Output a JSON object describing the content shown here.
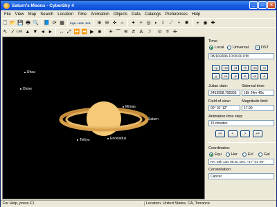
{
  "window": {
    "title": "Saturn's Moons - CyberSky 4"
  },
  "menu": [
    "File",
    "View",
    "Map",
    "Search",
    "Location",
    "Time",
    "Animation",
    "Objects",
    "Data",
    "Catalogs",
    "Preferences",
    "Help"
  ],
  "toolbar": {
    "leo_label": "Leo"
  },
  "sky": {
    "planet_label": "Saturn",
    "moons": {
      "rhea": "Rhea",
      "dione": "Dione",
      "mimas": "Mimas",
      "tethys": "Tethys",
      "enceladus": "Enceladus"
    },
    "colors": {
      "planet": "#f6c979",
      "rings": "#d8a04a",
      "background": "#000000"
    }
  },
  "panel": {
    "time_label": "Time:",
    "local_label": "Local",
    "universal_label": "Universal",
    "dst_label": "DST",
    "datetime_value": "08/10/2006 10:06:00 PM",
    "step_buttons": [
      "+y",
      "+m",
      "+d",
      "+h",
      "+m",
      "+s",
      "-y",
      "-m",
      "-d",
      "-h",
      "-m",
      "-s"
    ],
    "julian_label": "Julian date:",
    "julian_value": "2453958.708333",
    "sidereal_label": "Sidereal time:",
    "sidereal_value": "18h 24m 45s",
    "fov_label": "Field of view:",
    "fov_value": "00° 01' 12\"",
    "maglimit_label": "Magnitude limit:",
    "maglimit_value": "17.90",
    "anim_label": "Animation time step:",
    "anim_value": "15 minutes",
    "nav_buttons": [
      "<<",
      "<",
      ">",
      ">>"
    ],
    "coords_label": "Coordinates:",
    "equ_label": "Equ",
    "hor_label": "Hor",
    "ecl_label": "Ecl",
    "gal_label": "Gal",
    "coords_value": "RA: 09h 13m 09.4s, Dec: +17° 01' 06\"",
    "constellation_label": "Constellation:",
    "constellation_value": "Cancer"
  },
  "status": {
    "help": "For Help, press F1.",
    "location": "Location: United States, CA, Torrance"
  }
}
